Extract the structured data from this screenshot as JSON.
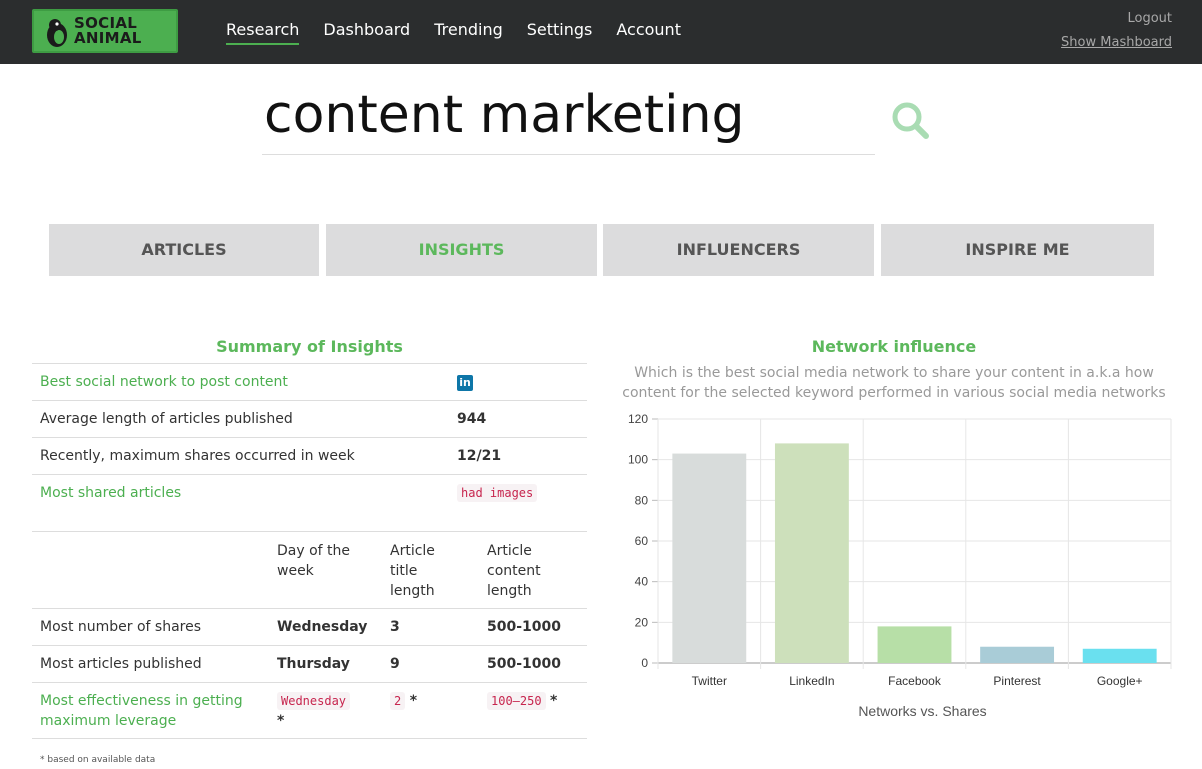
{
  "nav": {
    "logo_line1": "SOCIAL",
    "logo_line2": "ANIMAL",
    "links": [
      "Research",
      "Dashboard",
      "Trending",
      "Settings",
      "Account"
    ],
    "logout": "Logout",
    "show_mashboard": "Show Mashboard"
  },
  "search": {
    "value": "content marketing"
  },
  "tabs": [
    "ARTICLES",
    "INSIGHTS",
    "INFLUENCERS",
    "INSPIRE ME"
  ],
  "summary": {
    "title": "Summary of Insights",
    "best_network_label": "Best social network to post content",
    "best_network_icon": "in",
    "avg_length_label": "Average length of articles published",
    "avg_length_value": "944",
    "max_shares_label": "Recently, maximum shares occurred in week",
    "max_shares_value": "12/21",
    "most_shared_label": "Most shared articles",
    "most_shared_value": "had images"
  },
  "detail": {
    "headers": [
      "Day of the\nweek",
      "Article\ntitle\nlength",
      "Article\ncontent\nlength"
    ],
    "rows": [
      {
        "label": "Most number of shares",
        "day": "Wednesday",
        "title_len": "3",
        "content_len": "500-1000"
      },
      {
        "label": "Most articles published",
        "day": "Thursday",
        "title_len": "9",
        "content_len": "500-1000"
      },
      {
        "label": "Most effectiveness in getting maximum leverage",
        "day": "Wednesday",
        "title_len": "2",
        "content_len": "100–250",
        "star": "*"
      }
    ],
    "footnote": "* based on available data"
  },
  "chart_data": {
    "type": "bar",
    "title": "Network influence",
    "subtitle": "Which is the best social media network to share your content in a.k.a how content for the selected keyword performed in various social media networks",
    "categories": [
      "Twitter",
      "LinkedIn",
      "Facebook",
      "Pinterest",
      "Google+"
    ],
    "values": [
      103,
      108,
      18,
      8,
      7
    ],
    "colors": [
      "#d8dcdb",
      "#cde0bb",
      "#b7dfa7",
      "#a9ccd7",
      "#6ae0ef"
    ],
    "xlabel": "Networks vs. Shares",
    "ylabel": "",
    "ylim": [
      0,
      120
    ],
    "yticks": [
      0,
      20,
      40,
      60,
      80,
      100,
      120
    ],
    "grid": true
  }
}
